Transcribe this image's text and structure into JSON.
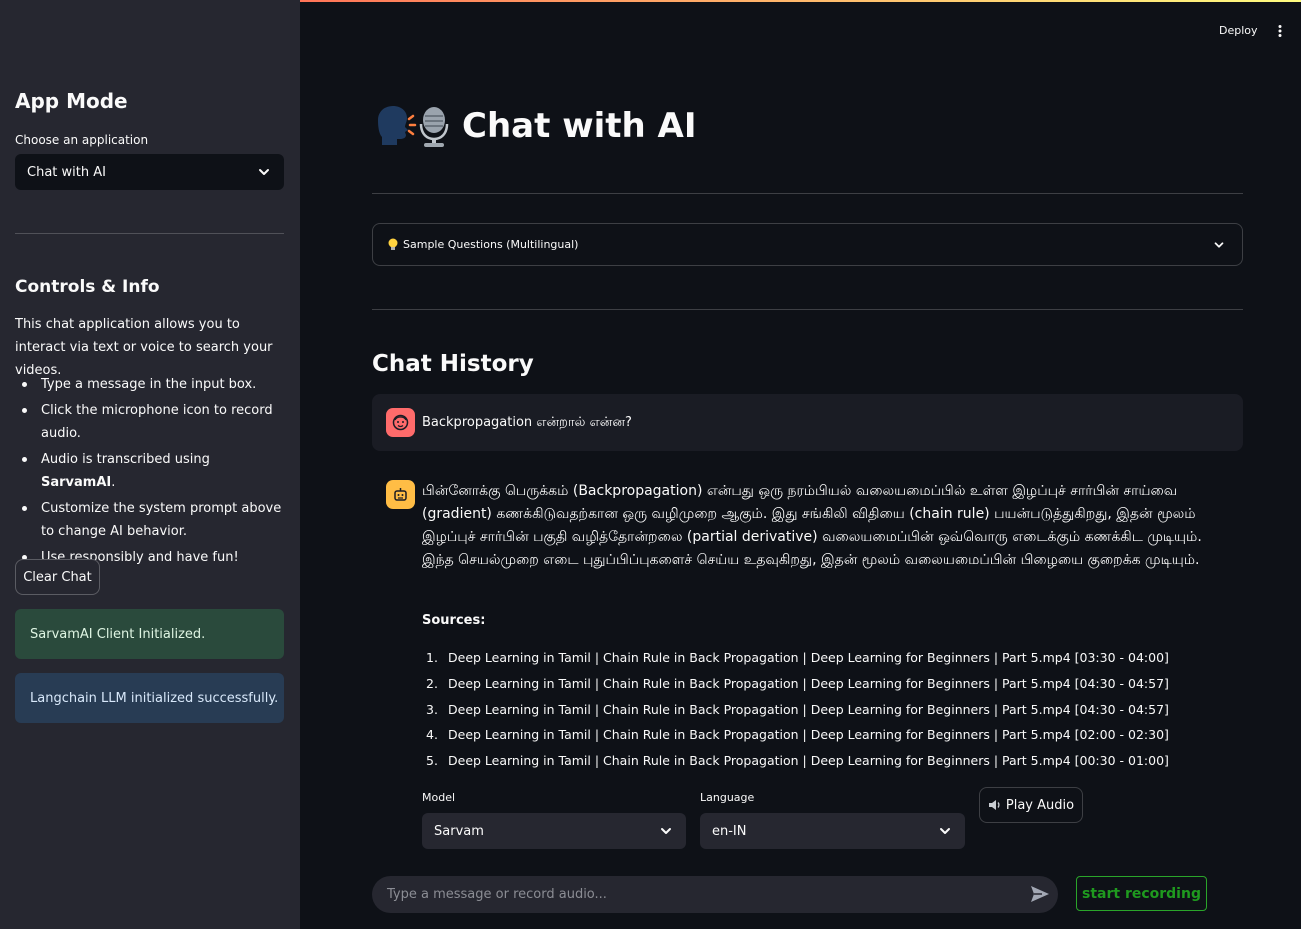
{
  "header": {
    "deploy_label": "Deploy"
  },
  "sidebar": {
    "title": "App Mode",
    "select_label": "Choose an application",
    "selected_app": "Chat with AI",
    "controls_title": "Controls & Info",
    "description": "This chat application allows you to interact via text or voice to search your videos.",
    "tips": [
      {
        "text": "Type a message in the input box."
      },
      {
        "text": "Click the microphone icon to record audio."
      },
      {
        "text_before": "Audio is transcribed using ",
        "bold": "SarvamAI",
        "text_after": "."
      },
      {
        "text": "Customize the system prompt above to change AI behavior."
      },
      {
        "text": "Use responsibly and have fun!"
      }
    ],
    "clear_button": "Clear Chat",
    "success_alert": "SarvamAI Client Initialized.",
    "info_alert": "Langchain LLM initialized successfully."
  },
  "main": {
    "title": "Chat with AI",
    "expander_label": "Sample Questions (Multilingual)",
    "chat_history_title": "Chat History",
    "user_message": "Backpropagation என்றால் என்ன?",
    "assistant_message": "பின்னோக்கு பெருக்கம் (Backpropagation) என்பது ஒரு நரம்பியல் வலையமைப்பில் உள்ள இழப்புச் சார்பின் சாய்வை (gradient) கணக்கிடுவதற்கான ஒரு வழிமுறை ஆகும். இது சங்கிலி விதியை (chain rule) பயன்படுத்துகிறது, இதன் மூலம் இழப்புச் சார்பின் பகுதி வழித்தோன்றலை (partial derivative) வலையமைப்பின் ஒவ்வொரு எடைக்கும் கணக்கிட முடியும். இந்த செயல்முறை எடை புதுப்பிப்புகளைச் செய்ய உதவுகிறது, இதன் மூலம் வலையமைப்பின் பிழையை குறைக்க முடியும்.",
    "sources_label": "Sources:",
    "sources": [
      {
        "num": "1.",
        "text": "Deep Learning in Tamil | Chain Rule in Back Propagation | Deep Learning for Beginners | Part 5.mp4 [03:30 - 04:00]"
      },
      {
        "num": "2.",
        "text": "Deep Learning in Tamil | Chain Rule in Back Propagation | Deep Learning for Beginners | Part 5.mp4 [04:30 - 04:57]"
      },
      {
        "num": "3.",
        "text": "Deep Learning in Tamil | Chain Rule in Back Propagation | Deep Learning for Beginners | Part 5.mp4 [04:30 - 04:57]"
      },
      {
        "num": "4.",
        "text": "Deep Learning in Tamil | Chain Rule in Back Propagation | Deep Learning for Beginners | Part 5.mp4 [02:00 - 02:30]"
      },
      {
        "num": "5.",
        "text": "Deep Learning in Tamil | Chain Rule in Back Propagation | Deep Learning for Beginners | Part 5.mp4 [00:30 - 01:00]"
      }
    ],
    "model_label": "Model",
    "model_value": "Sarvam",
    "language_label": "Language",
    "language_value": "en-IN",
    "play_audio": "Play Audio",
    "input_placeholder": "Type a message or record audio...",
    "record_button": "start recording"
  },
  "colors": {
    "background": "#0e1117",
    "sidebar": "#262730",
    "success": "#2a4a3c",
    "info": "#283c54",
    "record": "#1f9a1f",
    "user_avatar": "#ff6b6b",
    "bot_avatar": "#ffbd45"
  }
}
